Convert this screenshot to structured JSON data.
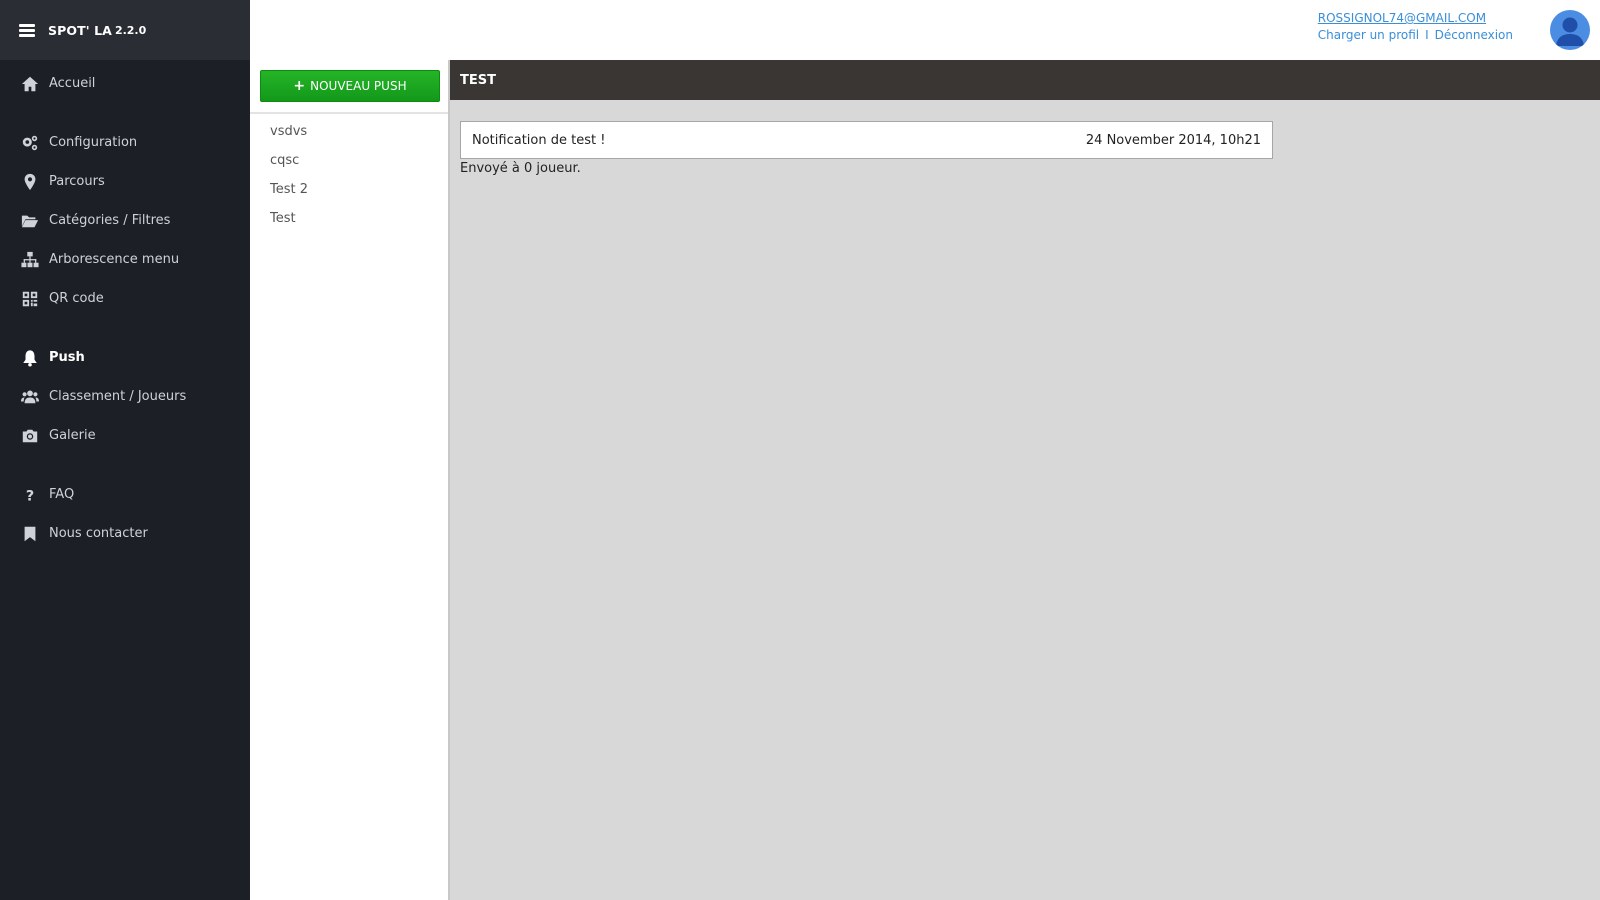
{
  "brand": {
    "title": "SPOT' LA",
    "version": "2.2.0"
  },
  "nav": {
    "items": [
      {
        "label": "Accueil",
        "icon": "home-icon"
      },
      {
        "label": "Configuration",
        "icon": "gears-icon"
      },
      {
        "label": "Parcours",
        "icon": "map-marker-icon"
      },
      {
        "label": "Catégories / Filtres",
        "icon": "folder-open-icon"
      },
      {
        "label": "Arborescence menu",
        "icon": "sitemap-icon"
      },
      {
        "label": "QR code",
        "icon": "qrcode-icon"
      },
      {
        "label": "Push",
        "icon": "bell-icon"
      },
      {
        "label": "Classement / Joueurs",
        "icon": "users-icon"
      },
      {
        "label": "Galerie",
        "icon": "camera-icon"
      },
      {
        "label": "FAQ",
        "icon": "question-icon"
      },
      {
        "label": "Nous contacter",
        "icon": "bookmark-icon"
      }
    ]
  },
  "user": {
    "email": "ROSSIGNOL74@GMAIL.COM",
    "load_profile": "Charger un profil",
    "separator": "I",
    "logout": "Déconnexion"
  },
  "list": {
    "new_push_label": "NOUVEAU PUSH",
    "items": [
      "vsdvs",
      "cqsc",
      "Test 2",
      "Test"
    ]
  },
  "detail": {
    "title": "TEST",
    "message": "Notification de test !",
    "date": "24 November 2014, 10h21",
    "sent_text": "Envoyé à 0 joueur."
  },
  "colors": {
    "sidebar_bg": "#1c1f26",
    "accent_green": "#1aa51f",
    "link_blue": "#3a8fd8",
    "header_dark": "#3a3633"
  }
}
